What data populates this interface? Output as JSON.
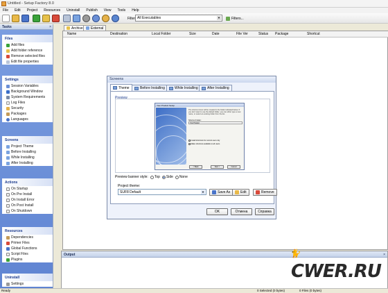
{
  "window": {
    "title": "Untitled - Setup Factory 8.0"
  },
  "menu": [
    "File",
    "Edit",
    "Project",
    "Resources",
    "Uninstall",
    "Publish",
    "View",
    "Tools",
    "Help"
  ],
  "filter": {
    "label": "Filter:",
    "value": "All Executables",
    "button": "Filters..."
  },
  "sidebar": {
    "title": "Tasks",
    "groups": [
      {
        "title": "Files",
        "items": [
          "Add files",
          "Add folder reference",
          "Remove selected files",
          "Edit file properties"
        ]
      },
      {
        "title": "Settings",
        "items": [
          "Session Variables",
          "Background Window",
          "System Requirements",
          "Log Files",
          "Security",
          "Packages",
          "Languages"
        ]
      },
      {
        "title": "Screens",
        "items": [
          "Project Theme",
          "Before Installing",
          "While Installing",
          "After Installing"
        ]
      },
      {
        "title": "Actions",
        "items": [
          "On Startup",
          "On Pre Install",
          "On Install Error",
          "On Post Install",
          "On Shutdown"
        ]
      },
      {
        "title": "Resources",
        "items": [
          "Dependencies",
          "Primer Files",
          "Global Functions",
          "Script Files",
          "Plugins"
        ]
      },
      {
        "title": "Uninstall",
        "items": [
          "Settings"
        ]
      }
    ]
  },
  "tabs": [
    "Archive",
    "External"
  ],
  "columns": [
    "Name",
    "Destination",
    "Local Folder",
    "Size",
    "Date",
    "File Ver",
    "Status",
    "Package",
    "Shortcut"
  ],
  "output": {
    "title": "Output"
  },
  "status": {
    "left": "Ready",
    "selected": "0 Selected (0 bytes)",
    "total": "0 Files (0 bytes)"
  },
  "dialog": {
    "title": "Screens",
    "tabs": [
      "Theme",
      "Before Installing",
      "While Installing",
      "After Installing"
    ],
    "preview_label": "Preview",
    "mini": {
      "title": "Your Product Setup",
      "text": "The shortcut icons will be created in the folder indicated below. If you don't want to use the default folder, you can either type a new name, or select an existing folder from the list.",
      "field_label": "Shortcut Folder:",
      "field_value": "Your Product",
      "option1": "Install shortcuts for current user only",
      "option2": "Make shortcuts available to all users",
      "back": "< Back",
      "next": "Next >",
      "cancel": "Cancel"
    },
    "banner_label": "Preview banner style:",
    "banner_options": [
      "Top",
      "Side",
      "None"
    ],
    "banner_selected": "Side",
    "theme_label": "Project theme:",
    "theme_value": "SUF8 Default",
    "save_as": "Save As",
    "edit": "Edit",
    "remove": "Remove",
    "ok": "OK",
    "cancel": "Отмена",
    "help": "Справка"
  },
  "watermark": "CWER.RU",
  "colors": {
    "accent": "#5f84d2",
    "group_title": "#1b3a8c"
  }
}
